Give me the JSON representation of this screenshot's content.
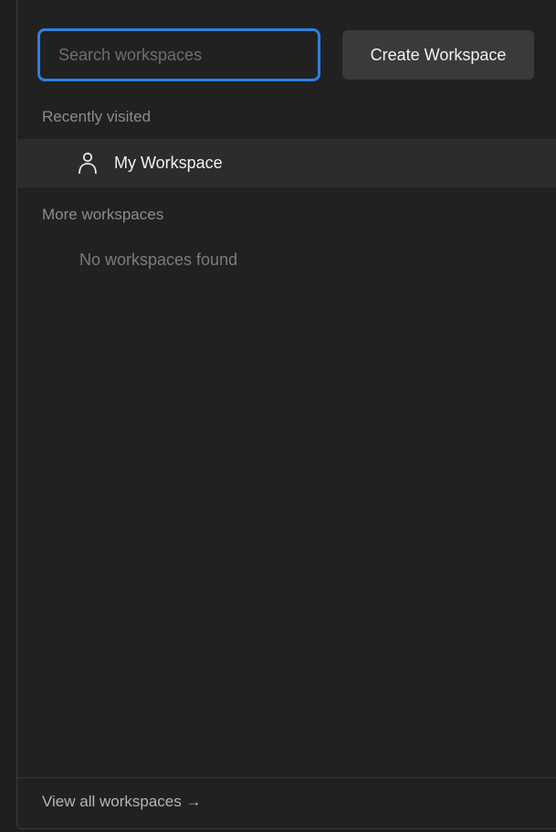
{
  "search": {
    "placeholder": "Search workspaces",
    "value": ""
  },
  "create_button_label": "Create Workspace",
  "sections": {
    "recent_heading": "Recently visited",
    "more_heading": "More workspaces"
  },
  "recent_items": [
    {
      "label": "My Workspace",
      "icon": "user-icon"
    }
  ],
  "more_empty_text": "No workspaces found",
  "footer": {
    "view_all_label": "View all workspaces →"
  },
  "colors": {
    "panel_bg": "#212121",
    "focus_ring": "#2f7fe0",
    "hover_row": "#2c2c2c",
    "button_bg": "#3a3a3a"
  }
}
